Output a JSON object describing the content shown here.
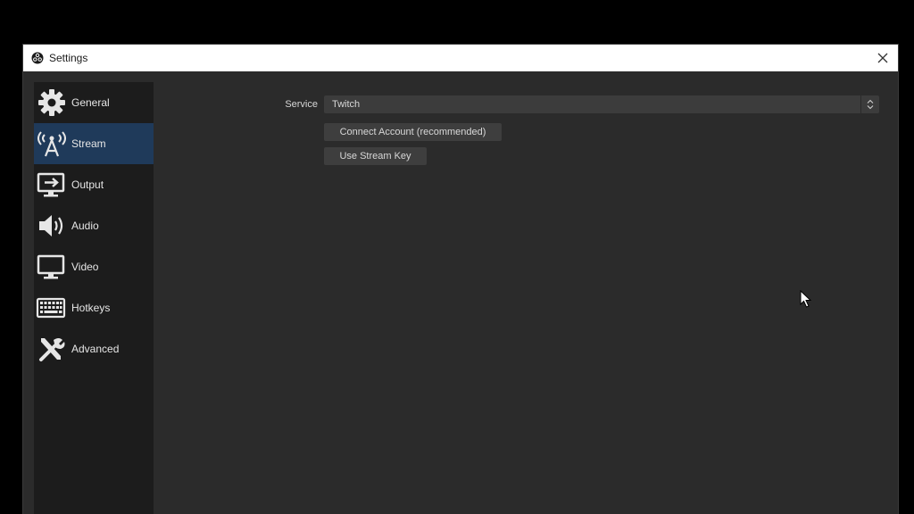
{
  "window": {
    "title": "Settings",
    "icon": "obs-logo-icon",
    "close_icon": "close-icon"
  },
  "sidebar": {
    "items": [
      {
        "label": "General",
        "icon": "gear-icon",
        "active": false
      },
      {
        "label": "Stream",
        "icon": "antenna-icon",
        "active": true
      },
      {
        "label": "Output",
        "icon": "monitor-output-icon",
        "active": false
      },
      {
        "label": "Audio",
        "icon": "speaker-icon",
        "active": false
      },
      {
        "label": "Video",
        "icon": "display-icon",
        "active": false
      },
      {
        "label": "Hotkeys",
        "icon": "keyboard-icon",
        "active": false
      },
      {
        "label": "Advanced",
        "icon": "tools-icon",
        "active": false
      }
    ]
  },
  "stream": {
    "service_label": "Service",
    "service_value": "Twitch",
    "connect_account_label": "Connect Account (recommended)",
    "use_stream_key_label": "Use Stream Key"
  },
  "colors": {
    "background": "#000000",
    "window_bg": "#2b2b2b",
    "sidebar_bg": "#1c1c1c",
    "active_item": "#1f3a5a",
    "button_bg": "#3e3e3e",
    "text": "#d8d8d8"
  }
}
